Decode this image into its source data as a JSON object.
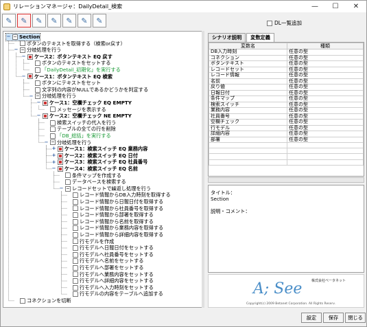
{
  "window": {
    "title": "リレーションマネージャ：DailyDetail_検索",
    "min": "—",
    "max": "☐",
    "close": "✕"
  },
  "toolbar": {
    "icons": [
      "doc-icon",
      "doc-edit-icon",
      "doc-add-icon",
      "doc-copy-icon",
      "doc-down-icon",
      "doc-up-icon",
      "doc-delete-icon"
    ]
  },
  "dl_add": {
    "label": "DL一覧追加",
    "checked": false
  },
  "tree": [
    {
      "t": "Section",
      "lvl": 0,
      "icon": "folder",
      "bold": true,
      "sel": true,
      "toggle": "minus"
    },
    {
      "t": "ボタンのテキストを取得する（検索or戻す）",
      "lvl": 1,
      "icon": "doc"
    },
    {
      "t": "分岐処理を行う",
      "lvl": 1,
      "icon": "folder",
      "toggle": "minus"
    },
    {
      "t": "ケース2：ボタンテキスト EQ 戻す",
      "lvl": 2,
      "icon": "case",
      "bold": true,
      "toggle": "minus"
    },
    {
      "t": "ボタンのテキストをセットする",
      "lvl": 3,
      "icon": "doc"
    },
    {
      "t": "「DailyDetail_初期化」を実行する",
      "lvl": 3,
      "icon": "doc",
      "green": true
    },
    {
      "t": "ケース1：ボタンテキスト EQ 検索",
      "lvl": 2,
      "icon": "case",
      "bold": true,
      "toggle": "minus"
    },
    {
      "t": "ボタンにテキストをセット",
      "lvl": 3,
      "icon": "doc"
    },
    {
      "t": "文字列の内容がNULLであるかどうかを判定する",
      "lvl": 3,
      "icon": "doc"
    },
    {
      "t": "分岐処理を行う",
      "lvl": 3,
      "icon": "folder",
      "toggle": "minus"
    },
    {
      "t": "ケース1：空欄チェック EQ EMPTY",
      "lvl": 4,
      "icon": "case",
      "bold": true,
      "toggle": "minus"
    },
    {
      "t": "メッセージを表示する",
      "lvl": 5,
      "icon": "doc"
    },
    {
      "t": "ケース2：空欄チェック NE EMPTY",
      "lvl": 4,
      "icon": "case",
      "bold": true,
      "toggle": "minus"
    },
    {
      "t": "検索スイッチの代入を行う",
      "lvl": 5,
      "icon": "doc"
    },
    {
      "t": "テーブルの全ての行を削除",
      "lvl": 5,
      "icon": "doc"
    },
    {
      "t": "「DB_総括」を実行する",
      "lvl": 5,
      "icon": "doc",
      "green": true
    },
    {
      "t": "分岐処理を行う",
      "lvl": 5,
      "icon": "folder",
      "toggle": "minus"
    },
    {
      "t": "ケース1：検索スイッチ EQ 業務内容",
      "lvl": 6,
      "icon": "case",
      "bold": true,
      "toggle": "plus"
    },
    {
      "t": "ケース2：検索スイッチ EQ 日付",
      "lvl": 6,
      "icon": "case",
      "bold": true,
      "toggle": "plus"
    },
    {
      "t": "ケース3：検索スイッチ EQ 社員番号",
      "lvl": 6,
      "icon": "case",
      "bold": true,
      "toggle": "plus"
    },
    {
      "t": "ケース4：検索スイッチ EQ 名前",
      "lvl": 6,
      "icon": "case",
      "bold": true,
      "toggle": "minus"
    },
    {
      "t": "条件マップを作成する",
      "lvl": 7,
      "icon": "doc"
    },
    {
      "t": "データベースを検索する",
      "lvl": 7,
      "icon": "doc"
    },
    {
      "t": "レコードセットで繰返し処理を行う",
      "lvl": 7,
      "icon": "folder",
      "toggle": "minus"
    },
    {
      "t": "レコード情報からDB入力時刻を取得する",
      "lvl": 8,
      "icon": "doc"
    },
    {
      "t": "レコード情報から日報日付を取得する",
      "lvl": 8,
      "icon": "doc"
    },
    {
      "t": "レコード情報から社員番号を取得する",
      "lvl": 8,
      "icon": "doc"
    },
    {
      "t": "レコード情報から部署を取得する",
      "lvl": 8,
      "icon": "doc"
    },
    {
      "t": "レコード情報から名前を取得する",
      "lvl": 8,
      "icon": "doc"
    },
    {
      "t": "レコード情報から業務内容を取得する",
      "lvl": 8,
      "icon": "doc"
    },
    {
      "t": "レコード情報から詳細内容を取得する",
      "lvl": 8,
      "icon": "doc"
    },
    {
      "t": "行モデルを作成",
      "lvl": 8,
      "icon": "doc"
    },
    {
      "t": "行モデルへ日報日付をセットする",
      "lvl": 8,
      "icon": "doc"
    },
    {
      "t": "行モデルへ社員番号をセットする",
      "lvl": 8,
      "icon": "doc"
    },
    {
      "t": "行モデルへ名前をセットする",
      "lvl": 8,
      "icon": "doc"
    },
    {
      "t": "行モデルへ部署をセットする",
      "lvl": 8,
      "icon": "doc"
    },
    {
      "t": "行モデルへ業務内容をセットする",
      "lvl": 8,
      "icon": "doc"
    },
    {
      "t": "行モデルへ詳細内容をセットする",
      "lvl": 8,
      "icon": "doc"
    },
    {
      "t": "行モデルへ入力時刻をセットする",
      "lvl": 8,
      "icon": "doc"
    },
    {
      "t": "行モデルの内容をテーブルへ追加する",
      "lvl": 8,
      "icon": "doc"
    },
    {
      "t": "コネクションを切断",
      "lvl": 1,
      "icon": "doc"
    }
  ],
  "tabs": [
    {
      "label": "シナリオ説明",
      "active": false
    },
    {
      "label": "変数定義",
      "active": true
    }
  ],
  "var_table": {
    "headers": [
      "変数名",
      "種類"
    ],
    "rows": [
      [
        "DB入力時刻",
        "任意の型"
      ],
      [
        "コネクション",
        "任意の型"
      ],
      [
        "ボタンテキスト",
        "任意の型"
      ],
      [
        "レコードセット",
        "任意の型"
      ],
      [
        "レコード情報",
        "任意の型"
      ],
      [
        "名前",
        "任意の型"
      ],
      [
        "戻り値",
        "任意の型"
      ],
      [
        "日報日付",
        "任意の型"
      ],
      [
        "条件マップ",
        "任意の型"
      ],
      [
        "検索スイッチ",
        "任意の型"
      ],
      [
        "業務内容",
        "任意の型"
      ],
      [
        "社員番号",
        "任意の型"
      ],
      [
        "空欄チェック",
        "任意の型"
      ],
      [
        "行モデル",
        "任意の型"
      ],
      [
        "詳細内容",
        "任意の型"
      ],
      [
        "部署",
        "任意の型"
      ]
    ]
  },
  "detail": {
    "title_label": "タイトル：",
    "title_value": "Section",
    "comment_label": "説明・コメント："
  },
  "logo": {
    "mark": "A; See",
    "ja": "株式会社ベータネット",
    "copyright": "Copyright(c) 2009 Betanet Corporation. All Rights Reserv."
  },
  "buttons": {
    "settings": "設定",
    "save": "保存",
    "close": "閉じる"
  }
}
